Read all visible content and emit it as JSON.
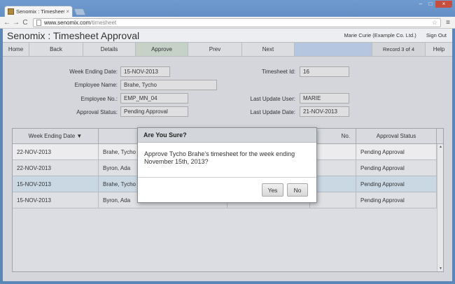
{
  "browser": {
    "tab_title": "Senomix : Timesheet Appr",
    "tab_close": "×",
    "url_domain": "www.senomix.com",
    "url_path": "/timesheet",
    "back": "←",
    "forward": "→",
    "reload": "C",
    "star": "☆",
    "menu": "≡",
    "win_min": "–",
    "win_max": "□",
    "win_close": "×"
  },
  "app": {
    "title": "Senomix : Timesheet Approval",
    "user": "Marie Curie  (Example Co. Ltd.)",
    "signout": "Sign Out"
  },
  "nav": {
    "home": "Home",
    "back": "Back",
    "details": "Details",
    "approve": "Approve",
    "prev": "Prev",
    "next": "Next",
    "record": "Record 3 of 4",
    "help": "Help"
  },
  "form": {
    "week_ending_label": "Week Ending Date:",
    "week_ending_value": "15-NOV-2013",
    "timesheet_id_label": "Timesheet Id:",
    "timesheet_id_value": "16",
    "employee_name_label": "Employee Name:",
    "employee_name_value": "Brahe, Tycho",
    "employee_no_label": "Employee No.:",
    "employee_no_value": "EMP_MN_04",
    "last_update_user_label": "Last Update User:",
    "last_update_user_value": "MARIE",
    "approval_status_label": "Approval Status:",
    "approval_status_value": "Pending Approval",
    "last_update_date_label": "Last Update Date:",
    "last_update_date_value": "21-NOV-2013"
  },
  "table": {
    "columns": [
      "Week Ending Date ▼",
      "",
      "",
      "No.",
      "Approval Status"
    ],
    "rows": [
      {
        "date": "22-NOV-2013",
        "name": "Brahe, Tycho",
        "status": "Pending Approval"
      },
      {
        "date": "22-NOV-2013",
        "name": "Byron, Ada",
        "status": "Pending Approval"
      },
      {
        "date": "15-NOV-2013",
        "name": "Brahe, Tycho",
        "status": "Pending Approval"
      },
      {
        "date": "15-NOV-2013",
        "name": "Byron, Ada",
        "status": "Pending Approval"
      }
    ],
    "selected_row": 2,
    "scroll_up": "▲",
    "scroll_down": "▼"
  },
  "dialog": {
    "title": "Are You Sure?",
    "message": "Approve Tycho Brahe's timesheet for the week ending November 15th, 2013?",
    "yes": "Yes",
    "no": "No"
  },
  "colors": {
    "window_frame": "#5a86b8",
    "approve_tab": "#c6d1c8",
    "blank_tab": "#b4c6e0",
    "selected_row": "#c9d8e3"
  }
}
